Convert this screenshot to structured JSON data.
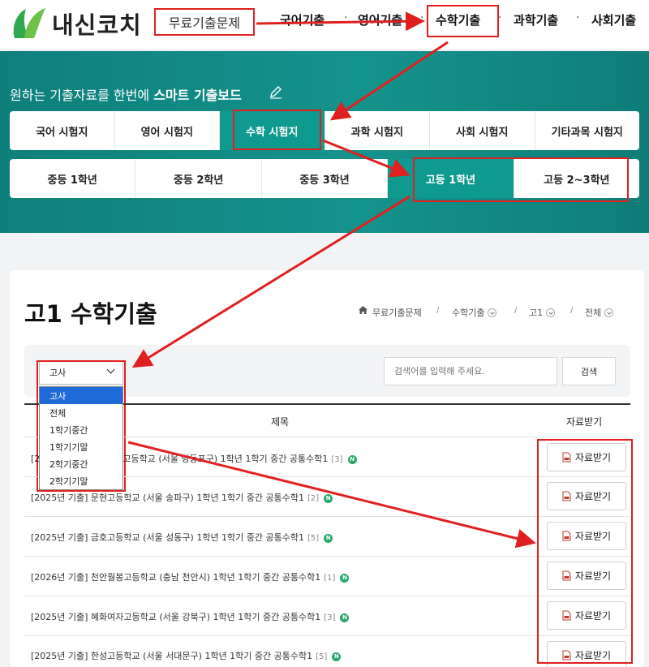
{
  "header": {
    "logo_text": "내신코치",
    "free_link": "무료기출문제",
    "nav": [
      "국어기출",
      "영어기출",
      "수학기출",
      "과학기출",
      "사회기출"
    ],
    "dot": "·"
  },
  "band": {
    "title_prefix": "원하는 기출자료를 한번에 ",
    "title_bold": "스마트 기출보드",
    "subjects": [
      "국어 시험지",
      "영어 시험지",
      "수학 시험지",
      "과학 시험지",
      "사회 시험지",
      "기타과목 시험지"
    ],
    "active_subject": 2,
    "grades": [
      "중등 1학년",
      "중등 2학년",
      "중등 3학년",
      "고등 1학년",
      "고등 2~3학년"
    ],
    "active_grade": 3
  },
  "page": {
    "title": "고1 수학기출",
    "breadcrumb": [
      "무료기출문제",
      "수학기출",
      "고1",
      "전체"
    ],
    "bc_sep": "/"
  },
  "search": {
    "select_value": "고사",
    "placeholder": "검색어를 입력해 주세요.",
    "button": "검색",
    "options": [
      "고사",
      "전체",
      "1학기중간",
      "1학기기말",
      "2학기중간",
      "2학기기말"
    ]
  },
  "table": {
    "headers": [
      "제목",
      "자료받기"
    ],
    "rows": [
      {
        "title": "[2025년 기출] ○○여자고등학교 (서울 영등포구) 1학년 1학기 중간 공통수학1",
        "count": "[3]",
        "badge": "N",
        "download": "자료받기"
      },
      {
        "title": "[2025년 기출] 문현고등학교 (서울 송파구) 1학년 1학기 중간 공통수학1",
        "count": "[2]",
        "badge": "N",
        "download": "자료받기"
      },
      {
        "title": "[2025년 기출] 금호고등학교 (서울 성동구) 1학년 1학기 중간 공통수학1",
        "count": "[5]",
        "badge": "N",
        "download": "자료받기"
      },
      {
        "title": "[2026년 기출] 천안월봉고등학교 (충남 천안시) 1학년 1학기 중간 공통수학1",
        "count": "[1]",
        "badge": "N",
        "download": "자료받기"
      },
      {
        "title": "[2025년 기출] 혜화여자고등학교 (서울 강북구) 1학년 1학기 중간 공통수학1",
        "count": "[3]",
        "badge": "N",
        "download": "자료받기"
      },
      {
        "title": "[2025년 기출] 한성고등학교 (서울 서대문구) 1학년 1학기 중간 공통수학1",
        "count": "[5]",
        "badge": "N",
        "download": "자료받기"
      }
    ]
  },
  "colors": {
    "teal": "#0e9a8f",
    "annotation": "#e02020",
    "selected": "#1e6ad6"
  }
}
